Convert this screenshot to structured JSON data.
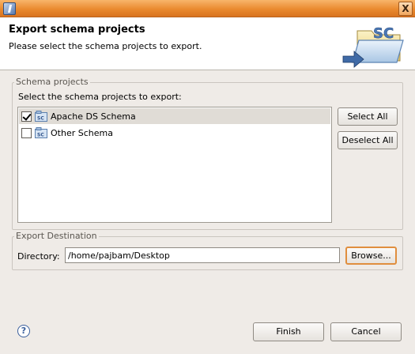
{
  "window": {
    "close_label": "X"
  },
  "header": {
    "title": "Export schema projects",
    "description": "Please select the schema projects to export.",
    "banner_text": "SC"
  },
  "projects_group": {
    "legend": "Schema projects",
    "instruction": "Select the schema projects to export:",
    "items": [
      {
        "label": "Apache DS Schema",
        "checked": true,
        "selected": true,
        "icon": "schema-project-icon"
      },
      {
        "label": "Other Schema",
        "checked": false,
        "selected": false,
        "icon": "schema-project-icon"
      }
    ],
    "select_all_label": "Select All",
    "deselect_all_label": "Deselect All"
  },
  "destination_group": {
    "legend": "Export Destination",
    "directory_label": "Directory:",
    "directory_value": "/home/pajbam/Desktop",
    "browse_label": "Browse..."
  },
  "footer": {
    "help_icon": "help-icon",
    "finish_label": "Finish",
    "cancel_label": "Cancel"
  },
  "colors": {
    "titlebar_accent": "#ea8a2f",
    "dialog_background": "#efebe7",
    "selected_row": "#e0dcd6",
    "focus_border": "#e08e3e"
  }
}
